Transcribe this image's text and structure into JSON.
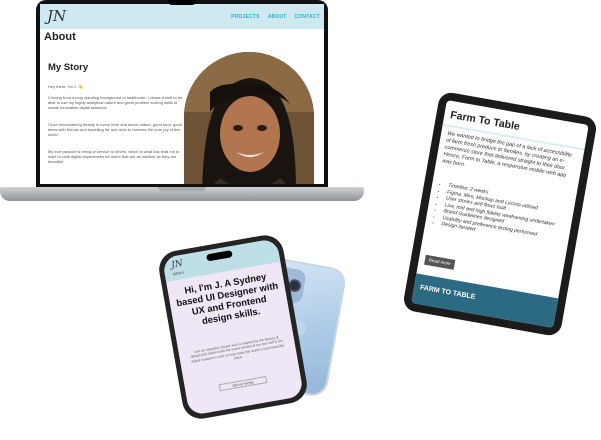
{
  "laptop": {
    "logo": "JN",
    "nav": [
      "PROJECTS",
      "ABOUT",
      "CONTACT"
    ],
    "page_title": "About",
    "section_title": "My Story",
    "paragraphs": [
      "Hey there, I'm J. 👋",
      "Coming from a long standing background of healthcare, I chose a shift to be able to use my highly analytical nature and great problem solving skills to create innovative digital solutions.",
      "I love encountering beauty in every form and adore nature, good food, good times with friends and travelling far and wide to harness the pure joy of this world.",
      "My true passion is being of service to others, which is what has lead me to want to craft digital experiences for users that are as intuitive as they are beautiful."
    ]
  },
  "tablet": {
    "title": "Farm To Table",
    "intro": "We wanted to bridge the gap of a lack of accessibility of farm fresh produce to families, by creating an e-commerce store that delivered straight to their door. Hence, Farm to Table, a responsive mobile web app was born.",
    "bullets": [
      "Timeline: 2 weeks",
      "Figma, Miro, Mockup and Lyssna utilised",
      "User stories and flows built",
      "Low, mid and high fidelity wireframing undertaken",
      "Brand Guidelines designed",
      "Usability and preference testing performed",
      "Design iterated"
    ],
    "button": "Read more",
    "banner": "FARM TO TABLE"
  },
  "phone": {
    "logo": "JN",
    "menu": "MENU",
    "headline": "Hi, I'm J. A Sydney based UI Designer with UX and Frontend design skills.",
    "body": "I am an empathic creator who is inspired by the beauty of design and seeks to be the truest version of my own self in the digital creations I craft, to help make the world a more beautiful place.",
    "button": "SEE MY WORK"
  }
}
